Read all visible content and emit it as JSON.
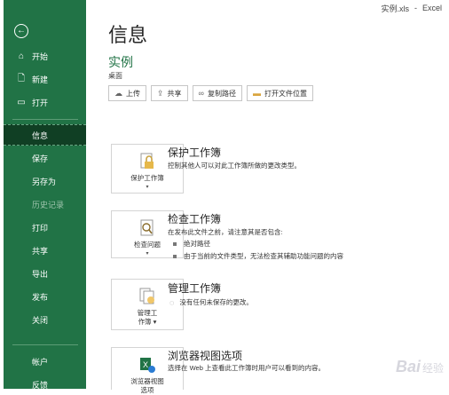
{
  "window": {
    "file": "实例.xls",
    "sep": "-",
    "app": "Excel"
  },
  "sidebar": {
    "back_icon": "back-arrow-icon",
    "items": [
      {
        "label": "开始",
        "icon": "home-icon"
      },
      {
        "label": "新建",
        "icon": "new-file-icon"
      },
      {
        "label": "打开",
        "icon": "open-folder-icon"
      },
      {
        "label": "信息",
        "active": true
      },
      {
        "label": "保存"
      },
      {
        "label": "另存为"
      },
      {
        "label": "历史记录",
        "disabled": true
      },
      {
        "label": "打印"
      },
      {
        "label": "共享"
      },
      {
        "label": "导出"
      },
      {
        "label": "发布"
      },
      {
        "label": "关闭"
      },
      {
        "label": "帐户"
      },
      {
        "label": "反馈"
      }
    ]
  },
  "main": {
    "title": "信息",
    "file_name": "实例",
    "file_location": "桌面",
    "buttons": [
      {
        "label": "上传",
        "icon": "upload-icon"
      },
      {
        "label": "共享",
        "icon": "share-icon"
      },
      {
        "label": "复制路径",
        "icon": "link-icon"
      },
      {
        "label": "打开文件位置",
        "icon": "folder-icon"
      }
    ],
    "sections": {
      "protect": {
        "card_label": "保护工作簿",
        "title": "保护工作簿",
        "desc": "控制其他人可以对此工作簿所做的更改类型。"
      },
      "inspect": {
        "card_label": "检查问题",
        "title": "检查工作簿",
        "desc": "在发布此文件之前，请注意其是否包含:",
        "bullets": [
          "绝对路径",
          "由于当前的文件类型，无法检查其辅助功能问题的内容"
        ]
      },
      "manage": {
        "card_label_1": "管理工",
        "card_label_2": "作簿",
        "title": "管理工作簿",
        "desc": "没有任何未保存的更改。"
      },
      "browser": {
        "card_label_1": "浏览器视图",
        "card_label_2": "选项",
        "title": "浏览器视图选项",
        "desc": "选择在 Web 上查看此工作簿时用户可以看到的内容。"
      }
    }
  },
  "watermark": {
    "brand": "Bai",
    "suffix": "经验"
  },
  "colors": {
    "sidebar": "#217346",
    "sidebar_active": "#103f24",
    "accent": "#217346"
  }
}
